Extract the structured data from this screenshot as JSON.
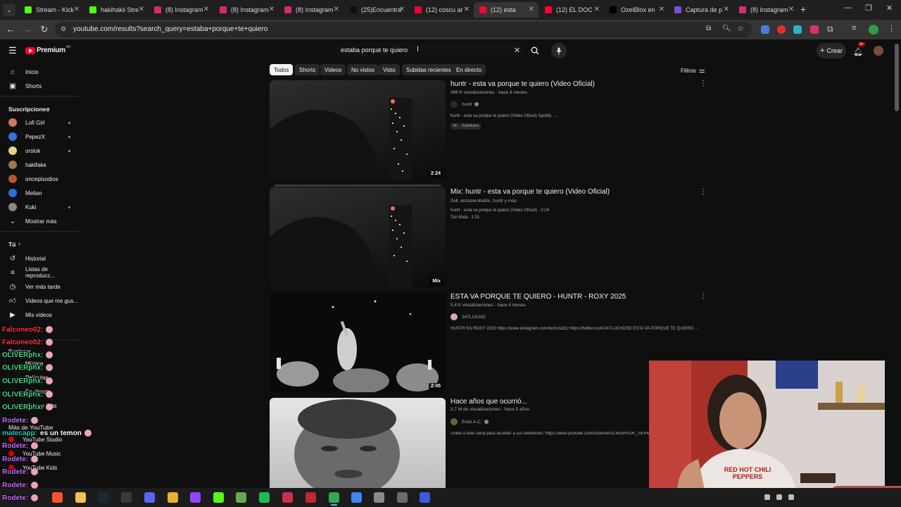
{
  "browser": {
    "tabs": [
      {
        "label": "Stream - Kick",
        "color": "#53fc18"
      },
      {
        "label": "hakihakii Stre",
        "color": "#53fc18"
      },
      {
        "label": "(8) Instagram",
        "color": "#d62976"
      },
      {
        "label": "(8) Instagram",
        "color": "#d62976"
      },
      {
        "label": "(8) Instagram",
        "color": "#d62976"
      },
      {
        "label": "(25)Encuentra",
        "color": "#111111"
      },
      {
        "label": "(12) coscu ar",
        "color": "#ff0033"
      },
      {
        "label": "(12) esta",
        "color": "#ff0033"
      },
      {
        "label": "(12) EL DOC",
        "color": "#ff0033"
      },
      {
        "label": "OzelBlox en",
        "color": "#000000"
      },
      {
        "label": "Captura de p",
        "color": "#7b4fd6"
      },
      {
        "label": "(8) Instagram",
        "color": "#d62976"
      }
    ],
    "new_tab": "+",
    "url": "youtube.com/results?search_query=estaba+porque+te+quiero"
  },
  "youtube": {
    "logo": "Premium",
    "logo_sup": "AR",
    "search_value": "estaba porque te quiero",
    "create_label": "Crear",
    "notif_count": "9+"
  },
  "chips": [
    "Todos",
    "Shorts",
    "Videos",
    "No vistos",
    "Visto",
    "Subidas recientes",
    "En directo"
  ],
  "filters_label": "Filtros",
  "sidebar": {
    "top": [
      {
        "label": "Inicio",
        "icon": "home-icon"
      },
      {
        "label": "Shorts",
        "icon": "shorts-icon"
      }
    ],
    "subs_title": "Suscripciones",
    "subs": [
      {
        "label": "Lofi Girl",
        "color": "#c77b5a",
        "live": true
      },
      {
        "label": "PepezX",
        "color": "#3f6fe0",
        "live": true
      },
      {
        "label": "orslok",
        "color": "#e6d28a",
        "live": true
      },
      {
        "label": "hakifake",
        "color": "#a07850",
        "live": false
      },
      {
        "label": "oncepisodios",
        "color": "#b5552e",
        "live": false
      },
      {
        "label": "Melian",
        "color": "#2c6fd6",
        "live": false
      },
      {
        "label": "Kuki",
        "color": "#888888",
        "live": true
      }
    ],
    "show_more": "Mostrar más",
    "you_title": "Tú",
    "you_items": [
      {
        "label": "Historial",
        "icon": "history-icon"
      },
      {
        "label": "Listas de reproducc...",
        "icon": "playlist-icon"
      },
      {
        "label": "Ver más tarde",
        "icon": "clock-icon"
      },
      {
        "label": "Videos que me gus...",
        "icon": "like-icon"
      },
      {
        "label": "Mis videos",
        "icon": "video-icon"
      }
    ],
    "explore_title": "Explorar",
    "explore_items": [
      "Música",
      "Películas",
      "En directo",
      "Mostrar más"
    ],
    "more_title": "Más de YouTube",
    "more_items": [
      "YouTube Studio",
      "YouTube Music",
      "YouTube Kids"
    ]
  },
  "results": [
    {
      "title": "huntr - esta va porque te quiero (Video Oficial)",
      "meta": "366 K visualizaciones · hace 8 meses",
      "channel": "huntr",
      "verified": true,
      "desc": "huntr - esta va porque te quiero (Video Oficial) Spotify: ...",
      "badges": [
        "4K",
        "Subtítulos"
      ],
      "duration": "2:24"
    },
    {
      "title": "Mix: huntr - esta va porque te quiero (Video Oficial)",
      "meta": "Zell, enzocerobulito, huntr y más",
      "line1": "huntr - esta va porque te quiero (Video Oficial) · 2:24",
      "line2": "Tan Mala · 1:51",
      "duration": "Mix"
    },
    {
      "title": "ESTA VA PORQUE TE QUIERO - HUNTR - ROXY 2025",
      "meta": "5,4 K visualizaciones · hace 4 meses",
      "channel": "247LUCHO",
      "desc": "HUNTR EN ROXY 2025 https://www.instagram.com/luchosd11/ https://twitter.com/247LUCHOSD ESTA VA PORQUE TE QUIERO ...",
      "duration": "2:45"
    },
    {
      "title": "Hace años que ocurrió...",
      "meta": "3,7 M de visualizaciones · hace 5 años",
      "channel": "Erick A.C.",
      "verified": true,
      "desc": "Únete a este canal para acceder a sus beneficios: https://www.youtube.com/channel/UCNuSRS1R_2IERM"
    }
  ],
  "chat": [
    {
      "user": "Falconeo02:",
      "msg": "",
      "color": "#ff3b3b"
    },
    {
      "user": "Falconeo02:",
      "msg": "",
      "color": "#ff3b3b"
    },
    {
      "user": "OLIVERphx:",
      "msg": "",
      "color": "#3ddc84"
    },
    {
      "user": "OLIVERphx:",
      "msg": "",
      "color": "#3ddc84"
    },
    {
      "user": "OLIVERphx:",
      "msg": "",
      "color": "#3ddc84"
    },
    {
      "user": "OLIVERphx:",
      "msg": "",
      "color": "#3ddc84"
    },
    {
      "user": "OLIVERphx:",
      "msg": "",
      "color": "#3ddc84"
    },
    {
      "user": "Rodete:",
      "msg": "",
      "color": "#c86bff"
    },
    {
      "user": "matecapp:",
      "msg": "es un temon",
      "color": "#2ec4b6"
    },
    {
      "user": "Rodete:",
      "msg": "",
      "color": "#c86bff"
    },
    {
      "user": "Rodete:",
      "msg": "",
      "color": "#c86bff"
    },
    {
      "user": "Rodete:",
      "msg": "",
      "color": "#c86bff"
    },
    {
      "user": "Rodete:",
      "msg": "",
      "color": "#c86bff"
    },
    {
      "user": "Rodete:",
      "msg": "",
      "color": "#c86bff"
    }
  ],
  "webcam": {
    "shirt_text": "RED HOT CHILI PEPPERS"
  }
}
